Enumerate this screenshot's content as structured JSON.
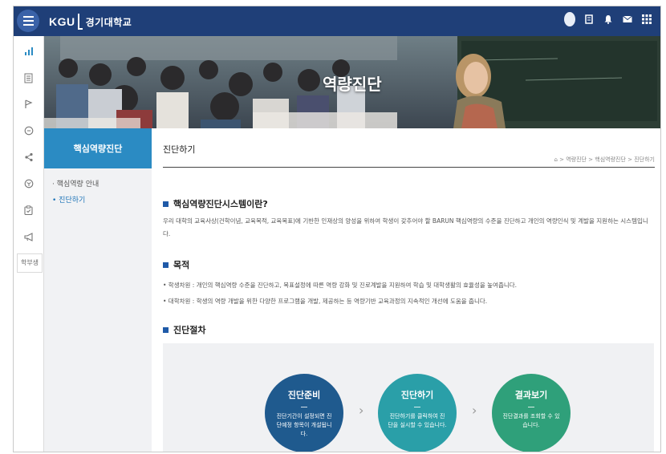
{
  "app": {
    "logo_text": "KGU",
    "logo_korean": "경기대학교"
  },
  "colors": {
    "topbar": "#1f3f78",
    "accent": "#2b8bc3",
    "step1": "#1f5a8e",
    "step2": "#2a9fa8",
    "step3": "#2fa07a"
  },
  "topbar_icons": [
    "user-avatar-icon",
    "document-icon",
    "bell-icon",
    "mail-icon",
    "grid-icon"
  ],
  "rail": {
    "icons": [
      "chart-icon",
      "document-icon",
      "flag-icon",
      "chat-icon",
      "share-icon",
      "cube-icon",
      "clipboard-icon",
      "megaphone-icon"
    ],
    "text_label": "학부생"
  },
  "hero": {
    "title": "역량진단"
  },
  "leftnav": {
    "heading": "핵심역량진단",
    "items": [
      {
        "label": "· 핵심역량 안내"
      },
      {
        "label": "• 진단하기"
      }
    ]
  },
  "main": {
    "page_title": "진단하기",
    "breadcrumb": "⌂ > 역량진단 > 핵심역량진단 > 진단하기",
    "sections": {
      "intro_heading": "핵심역량진단시스템이란?",
      "intro_text": "우리 대학의 교육사상(건학이념, 교육목적, 교육목표)에 기반한 인재상의 양성을 위하여 학생이 갖추어야 할 BARUN 핵심역량의 수준을 진단하고 개인의 역량인식 및 계발을 지원하는 시스템입니다.",
      "purpose_heading": "목적",
      "purpose_items": [
        "• 학생차원 : 개인의 핵심역량 수준을 진단하고, 목표설정에 따른 역량 강화 및 진로계발을 지원하여 학습 및 대학생활의 효율성을 높여줍니다.",
        "• 대학차원 : 학생의 역량 개발을 위한 다양한 프로그램을 개발, 제공하는 등 역량기반 교육과정의 지속적인 개선에 도움을 줍니다."
      ],
      "procedure_heading": "진단절차"
    },
    "steps": [
      {
        "title": "진단준비",
        "desc": "진단기간이 설정되면 진단예정 항목이 개설됩니다."
      },
      {
        "title": "진단하기",
        "desc": "진단하기를 클릭하여 진단을 실시할 수 있습니다."
      },
      {
        "title": "결과보기",
        "desc": "진단결과를 조회할 수 있습니다."
      }
    ],
    "step_separator": "›"
  }
}
